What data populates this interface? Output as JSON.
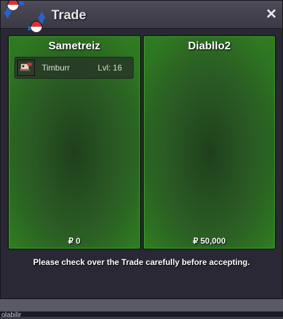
{
  "window": {
    "title": "Trade",
    "close_icon": "close-icon"
  },
  "trade": {
    "left": {
      "player": "Sametreiz",
      "items": [
        {
          "sprite": "pokemon-sprite-icon",
          "name": "Timburr",
          "level": "Lvl: 16"
        }
      ],
      "money": "₽ 0"
    },
    "right": {
      "player": "Diabllo2",
      "items": [],
      "money": "₽ 50,000"
    }
  },
  "footer": {
    "message": "Please check over the Trade carefully before accepting."
  },
  "background": {
    "label": "olabilir"
  },
  "colors": {
    "panel_green": "#2f7a22",
    "title_bar": "#45434f",
    "window_bg": "#2a2834"
  }
}
